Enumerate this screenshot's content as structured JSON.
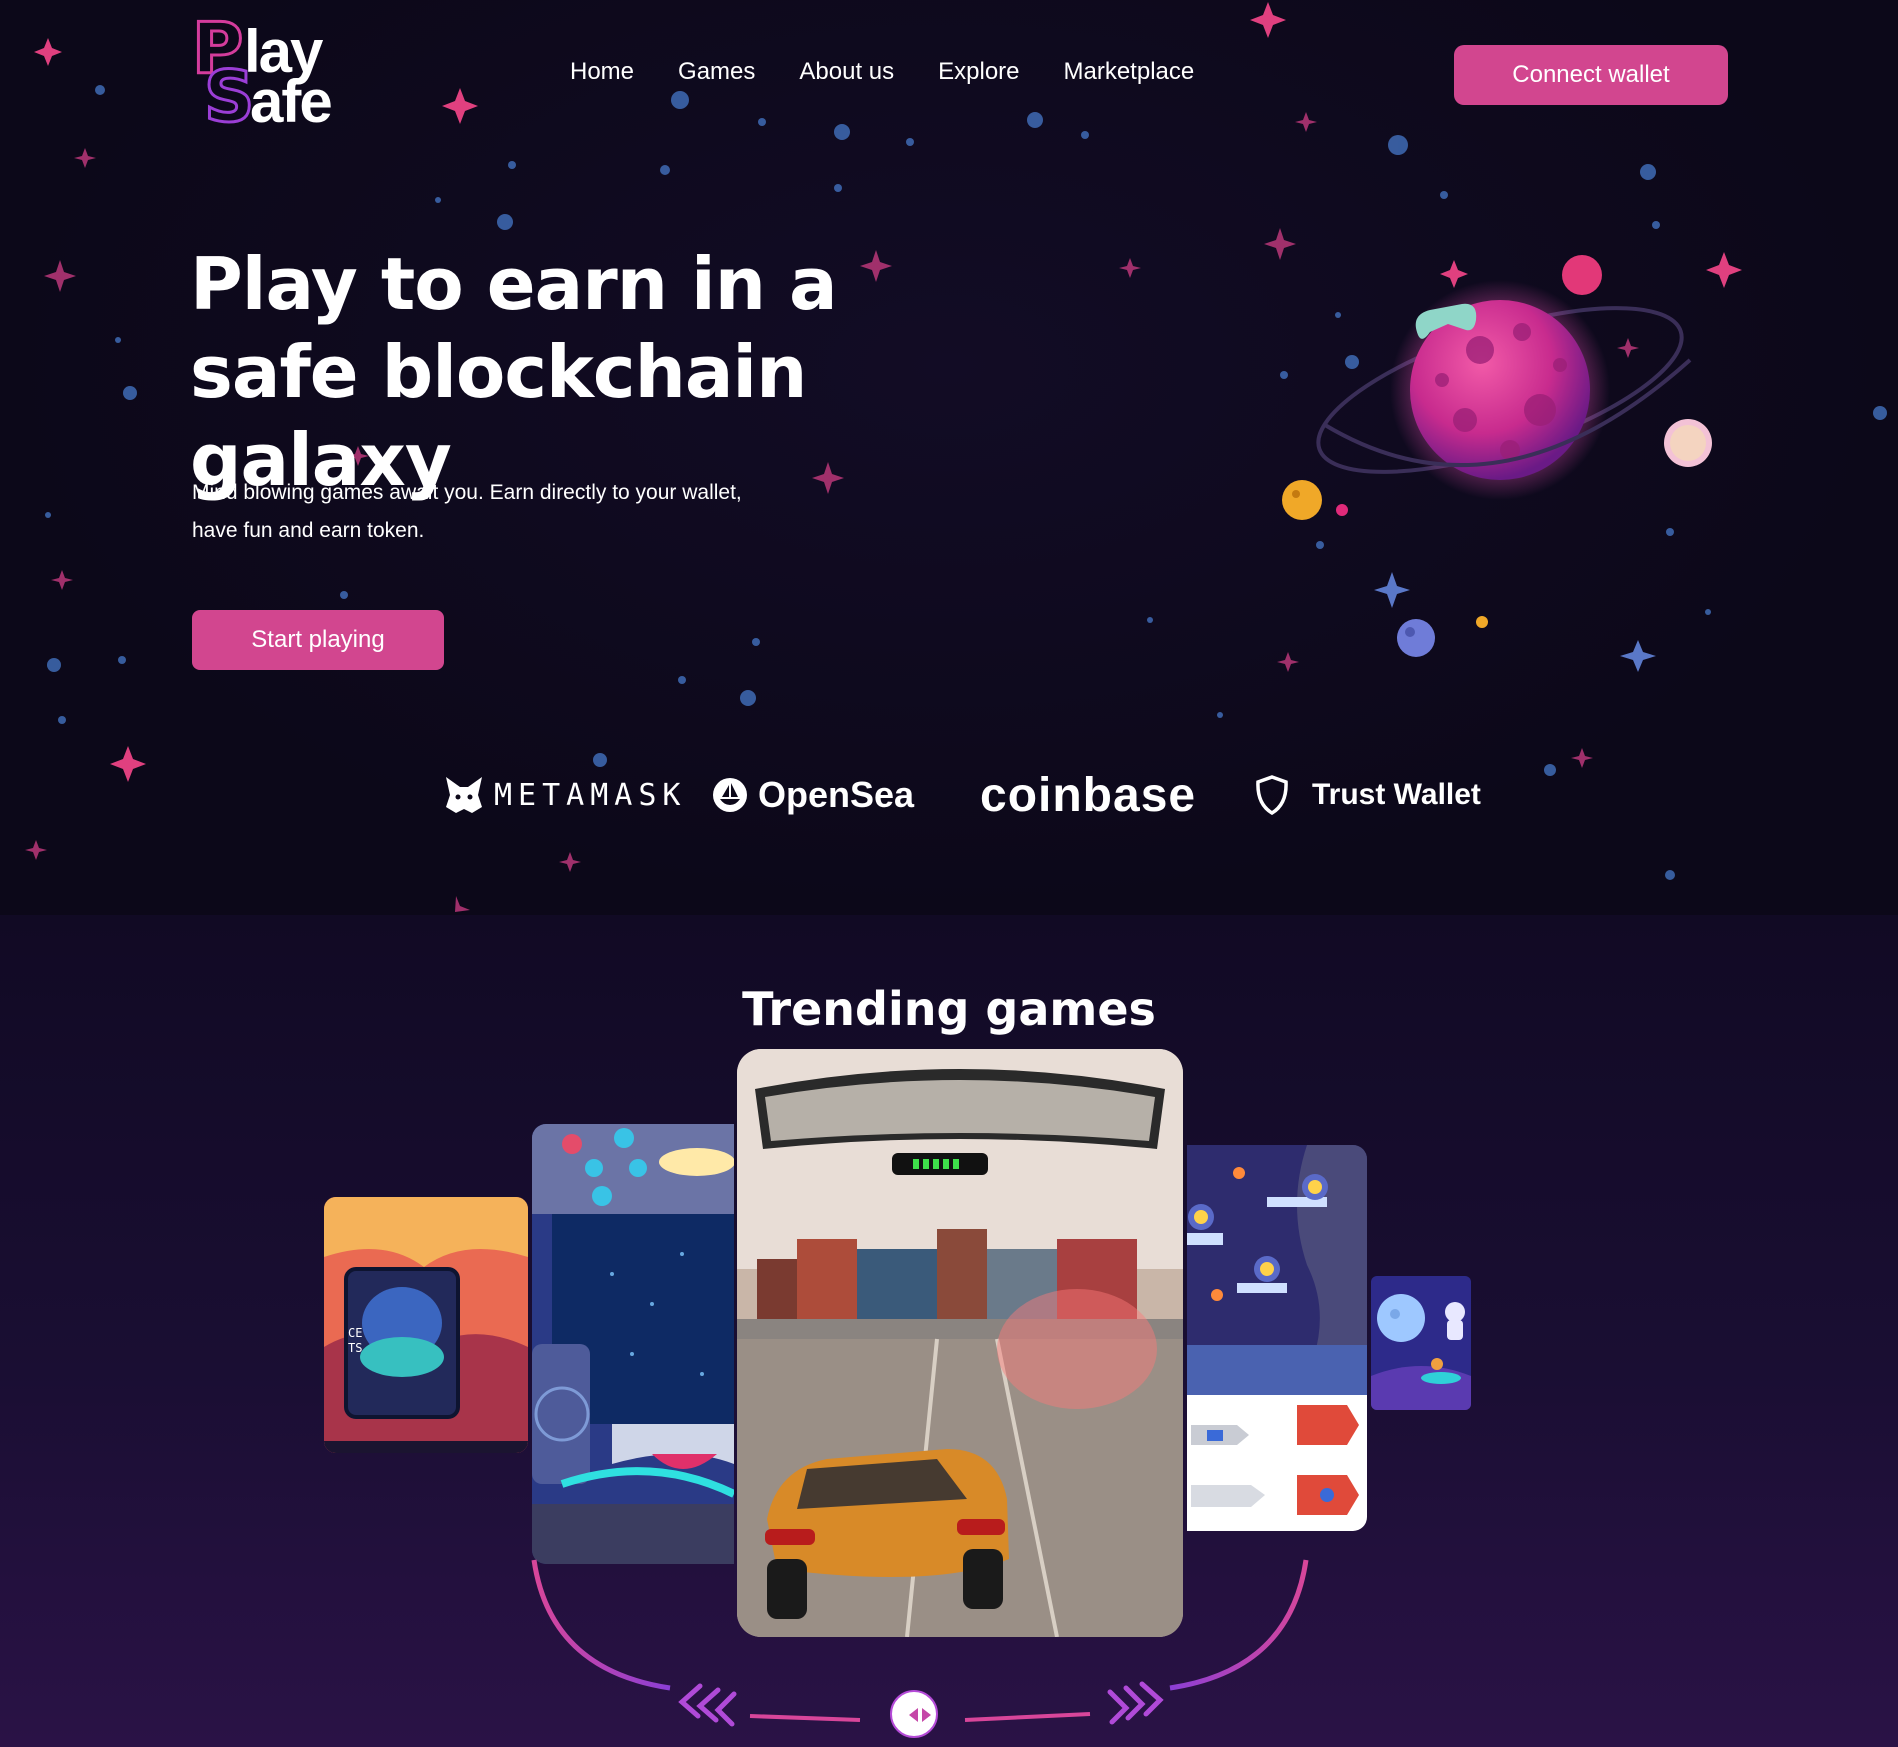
{
  "brand": {
    "logo_line1": "Play",
    "logo_line2": "Safe",
    "logo_p": "P",
    "logo_lay": "lay",
    "logo_s": "S",
    "logo_afe": "afe"
  },
  "nav": {
    "items": [
      "Home",
      "Games",
      "About us",
      "Explore",
      "Marketplace"
    ]
  },
  "header": {
    "connect_label": "Connect wallet"
  },
  "hero": {
    "headline": "Play to earn in a safe blockchain galaxy",
    "subtitle": "Mind blowing games await you. Earn directly to your wallet, have fun and earn token.",
    "cta_label": "Start playing"
  },
  "partners": [
    "METAMASK",
    "OpenSea",
    "coinbase",
    "Trust Wallet"
  ],
  "trending": {
    "title": "Trending games",
    "cards": [
      {
        "name": "mars-base-game",
        "card_text": "CE\nTS"
      },
      {
        "name": "spaceship-cockpit-game"
      },
      {
        "name": "racing-car-game"
      },
      {
        "name": "space-platformer-game"
      },
      {
        "name": "astronaut-moon-game"
      }
    ]
  },
  "colors": {
    "accent": "#d2468f",
    "background": "#0f0a1f",
    "purple": "#9b3ed6"
  },
  "icons": [
    "metamask-fox-icon",
    "opensea-boat-icon",
    "trust-wallet-shield-icon",
    "gamepad-icon",
    "carousel-arrows-icon"
  ]
}
